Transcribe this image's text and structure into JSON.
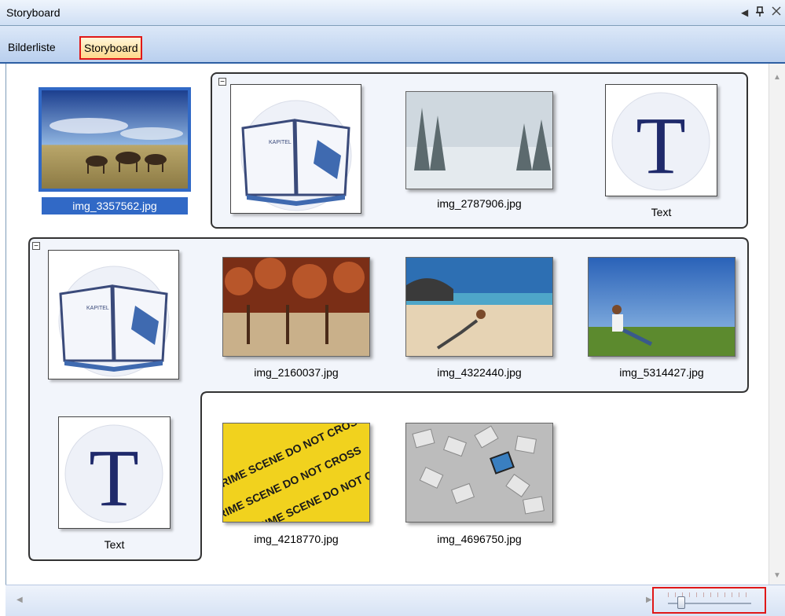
{
  "window": {
    "title": "Storyboard",
    "controls": {
      "pin_icon": "pin-icon",
      "close_icon": "close-icon",
      "menu_arrow": "dropdown-arrow-icon"
    }
  },
  "tabs": [
    {
      "label": "Bilderliste",
      "active": false
    },
    {
      "label": "Storyboard",
      "active": true
    }
  ],
  "items": {
    "standalone": {
      "label": "img_3357562.jpg",
      "selected": true
    },
    "group1": [
      {
        "type": "chapter",
        "label": ""
      },
      {
        "type": "photo",
        "label": "img_2787906.jpg"
      },
      {
        "type": "text",
        "label": "Text"
      }
    ],
    "group2": [
      {
        "type": "chapter",
        "label": ""
      },
      {
        "type": "photo",
        "label": "img_2160037.jpg"
      },
      {
        "type": "photo",
        "label": "img_4322440.jpg"
      },
      {
        "type": "photo",
        "label": "img_5314427.jpg"
      },
      {
        "type": "text",
        "label": "Text"
      },
      {
        "type": "photo",
        "label": "img_4218770.jpg"
      },
      {
        "type": "photo",
        "label": "img_4696750.jpg"
      }
    ],
    "chapter_book_text": "KAPITEL",
    "crime_tape_text": "CRIME SCENE DO NOT CROSS",
    "text_glyph": "T"
  },
  "collapse_glyph": "−",
  "colors": {
    "selection": "#3169c6",
    "highlight_border": "#e01818",
    "tab_active_bg": "#ffd98a",
    "text_glyph": "#1f2a6b"
  }
}
